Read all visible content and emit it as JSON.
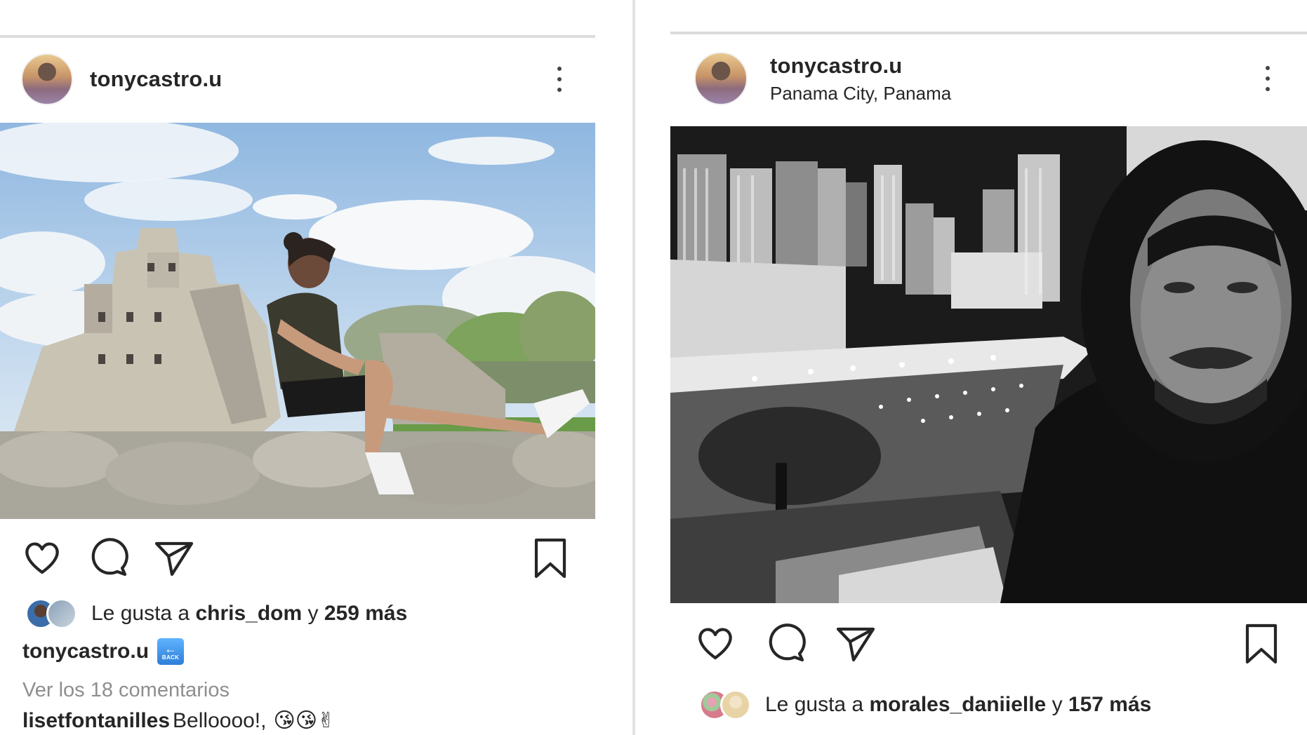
{
  "posts": [
    {
      "username": "tonycastro.u",
      "location": "",
      "liked_by_prefix": "Le gusta a ",
      "liked_by_user": "chris_dom",
      "liked_by_connector": " y ",
      "liked_by_more": "259 más",
      "caption_user": "tonycastro.u",
      "caption_badge_text": "BACK",
      "view_comments": "Ver los 18 comentarios",
      "comment_user": "lisetfontanilles",
      "comment_text": "Belloooo!,",
      "comment_emoji": "😘😘✌",
      "photo_description_icon": "photo-ruins-icon"
    },
    {
      "username": "tonycastro.u",
      "location": "Panama City, Panama",
      "liked_by_prefix": "Le gusta a ",
      "liked_by_user": "morales_daniielle",
      "liked_by_connector": " y ",
      "liked_by_more": "157 más",
      "photo_description_icon": "photo-city-night-icon"
    }
  ],
  "colors": {
    "text": "#262626",
    "secondary_text": "#8e8e8e",
    "divider": "#dcdcdc",
    "badge_blue": "#2f7fd9"
  },
  "icons": [
    "heart-icon",
    "comment-icon",
    "share-icon",
    "bookmark-icon",
    "more-options-icon"
  ]
}
